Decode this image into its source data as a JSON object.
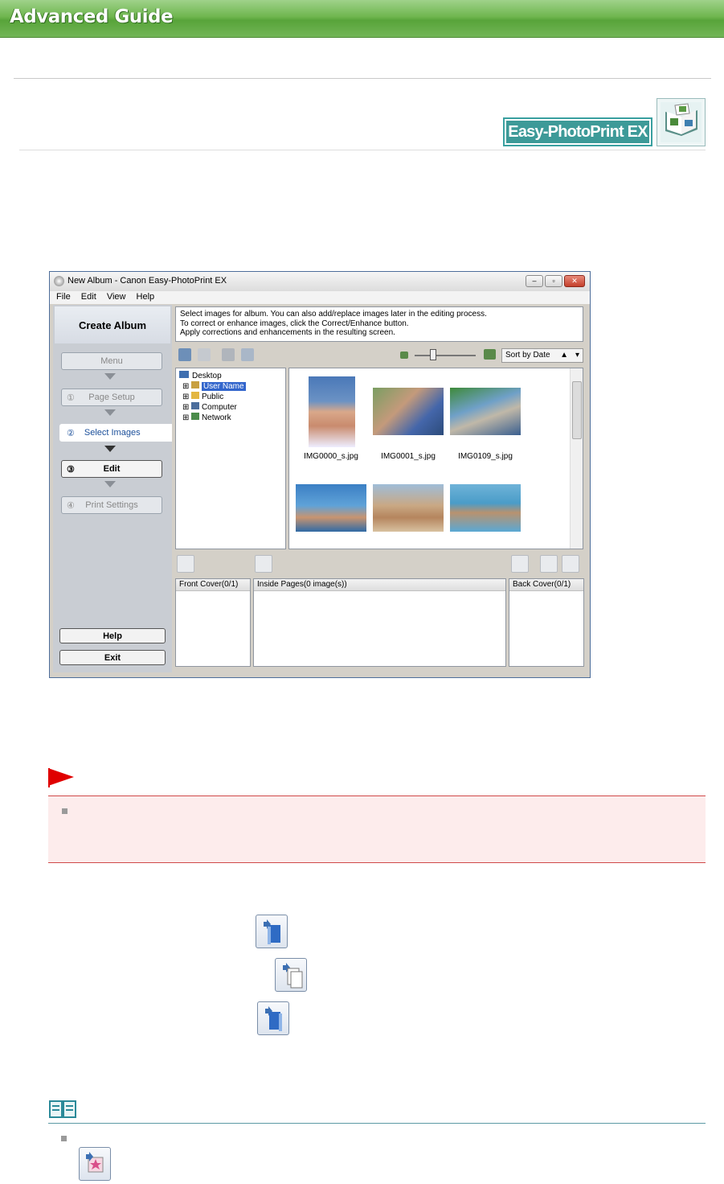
{
  "header": {
    "title": "Advanced Guide"
  },
  "logo": {
    "text": "Easy-PhotoPrint EX",
    "icon": "album-book-icon"
  },
  "window": {
    "title": "New Album - Canon Easy-PhotoPrint EX",
    "menu": [
      "File",
      "Edit",
      "View",
      "Help"
    ],
    "sidebar": {
      "heading": "Create Album",
      "steps": [
        {
          "num": "",
          "label": "Menu"
        },
        {
          "num": "①",
          "label": "Page Setup"
        },
        {
          "num": "②",
          "label": "Select Images"
        },
        {
          "num": "③",
          "label": "Edit"
        },
        {
          "num": "④",
          "label": "Print Settings"
        }
      ],
      "help": "Help",
      "exit": "Exit"
    },
    "instructions": [
      "Select images for album. You can also add/replace images later in the editing process.",
      "To correct or enhance images, click the Correct/Enhance button.",
      "Apply corrections and enhancements in the resulting screen."
    ],
    "sort": "Sort by Date",
    "tree": [
      "Desktop",
      "User Name",
      "Public",
      "Computer",
      "Network"
    ],
    "thumbnails": [
      "IMG0000_s.jpg",
      "IMG0001_s.jpg",
      "IMG0109_s.jpg"
    ],
    "panes": {
      "front": "Front Cover(0/1)",
      "inside": "Inside Pages(0 image(s))",
      "back": "Back Cover(0/1)"
    }
  },
  "colors": {
    "header_green": "#6fb64f",
    "important_red": "#e00000",
    "important_bg": "#fdecec",
    "logo_teal": "#3d9a98"
  }
}
